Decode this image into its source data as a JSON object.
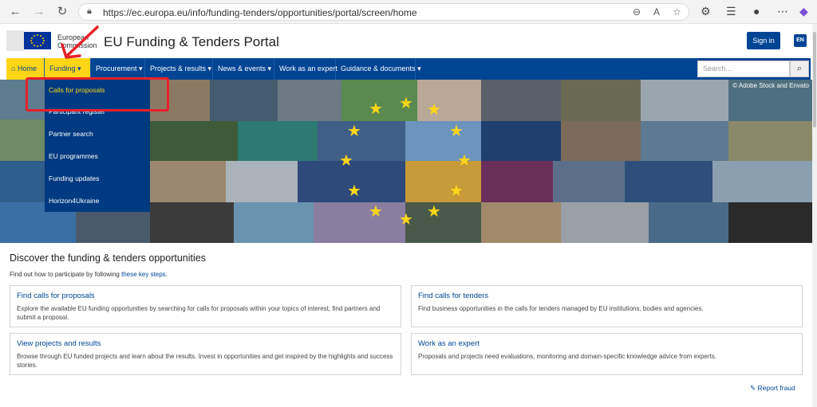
{
  "browser": {
    "url": "https://ec.europa.eu/info/funding-tenders/opportunities/portal/screen/home"
  },
  "header": {
    "ec_line1": "European",
    "ec_line2": "Commission",
    "title": "EU Funding & Tenders Portal",
    "sign_in": "Sign in",
    "lang": "EN"
  },
  "nav": {
    "home": "Home",
    "items": [
      "Funding",
      "Procurement",
      "Projects & results",
      "News & events",
      "Work as an expert",
      "Guidance & documents"
    ],
    "search_placeholder": "Search..."
  },
  "dropdown": {
    "items": [
      "Calls for proposals",
      "Participant register",
      "Partner search",
      "EU programmes",
      "Funding updates",
      "Horizon4Ukraine"
    ]
  },
  "banner": {
    "credit": "© Adobe Stock and Envato"
  },
  "main": {
    "heading": "Discover the funding & tenders opportunities",
    "subline_pre": "Find out how to participate by following ",
    "subline_link": "these key steps",
    "subline_post": ".",
    "cards": [
      {
        "title": "Find calls for proposals",
        "desc": "Explore the available EU funding opportunities by searching for calls for proposals within your topics of interest, find partners and submit a proposal."
      },
      {
        "title": "Find calls for tenders",
        "desc": "Find business opportunities in the calls for tenders managed by EU institutions, bodies and agencies."
      },
      {
        "title": "View projects and results",
        "desc": "Browse through EU funded projects and learn about the results. Invest in opportunities and get inspired by the highlights and success stories."
      },
      {
        "title": "Work as an expert",
        "desc": "Proposals and projects need evaluations, monitoring and domain-specific knowledge advice from experts."
      }
    ],
    "report_fraud": "Report fraud"
  },
  "colors": {
    "eu_blue": "#004494",
    "eu_yellow": "#ffd617",
    "annotation_red": "#e8202a"
  }
}
